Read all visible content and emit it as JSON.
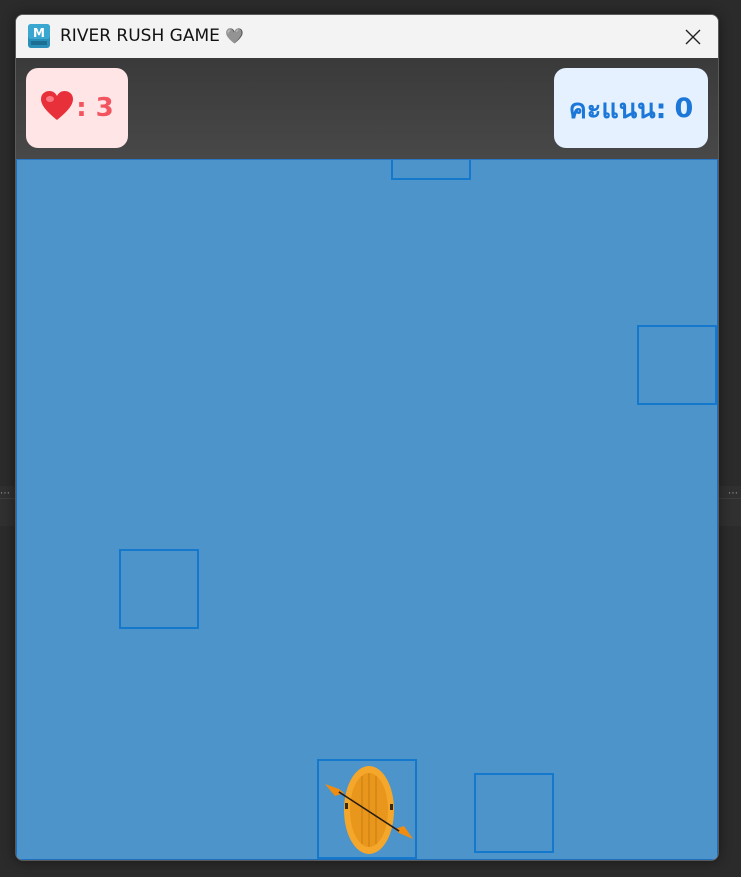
{
  "window": {
    "title": "RIVER RUSH GAME",
    "title_emoji": "🩶",
    "app_icon": "maya-app-icon",
    "close_icon": "close-icon"
  },
  "hud": {
    "lives": {
      "icon": "heart-icon",
      "text": ": 3",
      "value": 3,
      "color": "#f25560",
      "background": "#ffe5e5"
    },
    "score": {
      "label": "คะแนน:",
      "value": "0",
      "color": "#1b78d8",
      "background": "#e6f1ff"
    }
  },
  "river": {
    "color": "#4d94cb",
    "obstacle_outline_color": "#1479cc",
    "obstacles": [
      {
        "name": "obstacle-top-center"
      },
      {
        "name": "obstacle-right"
      },
      {
        "name": "obstacle-left"
      },
      {
        "name": "obstacle-bottom-right"
      }
    ],
    "player": {
      "name": "player-boat",
      "icon": "rowboat-icon",
      "colors": {
        "hull": "#f4a72a",
        "deck": "#e8961c",
        "oar": "#f08c10"
      }
    }
  }
}
